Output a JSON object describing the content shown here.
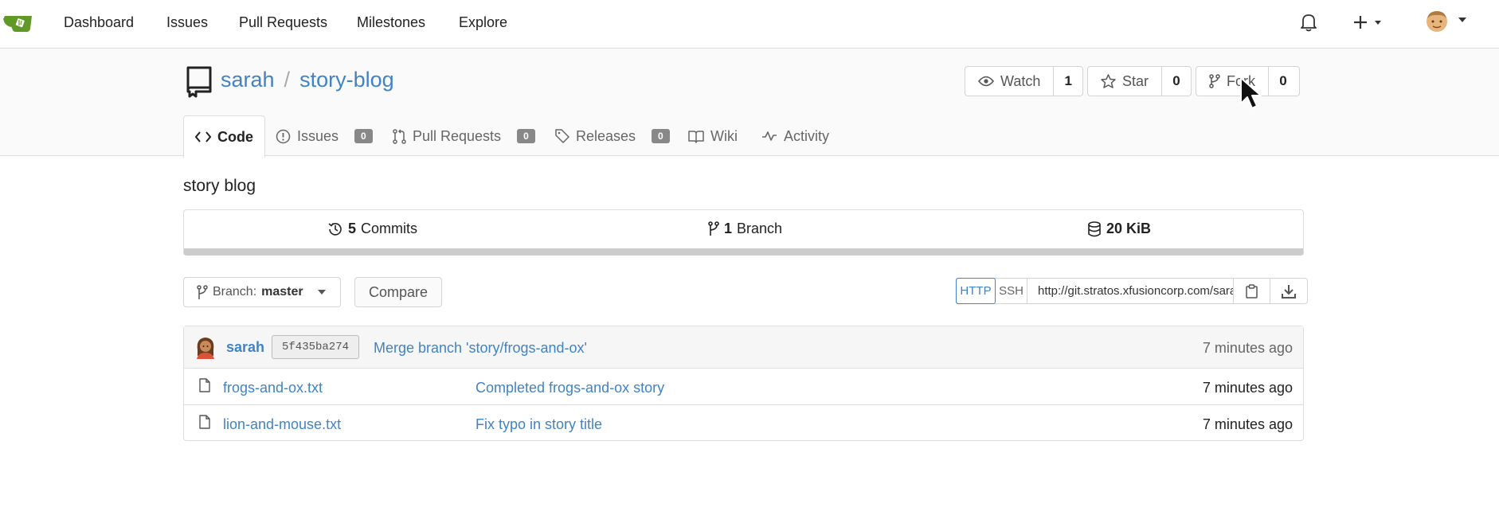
{
  "nav": {
    "items": [
      "Dashboard",
      "Issues",
      "Pull Requests",
      "Milestones",
      "Explore"
    ]
  },
  "repo": {
    "owner": "sarah",
    "name": "story-blog",
    "description": "story blog"
  },
  "actions": {
    "watch_label": "Watch",
    "watch_count": "1",
    "star_label": "Star",
    "star_count": "0",
    "fork_label": "Fork",
    "fork_count": "0"
  },
  "tabs": {
    "code": "Code",
    "issues": "Issues",
    "issues_count": "0",
    "pulls": "Pull Requests",
    "pulls_count": "0",
    "releases": "Releases",
    "releases_count": "0",
    "wiki": "Wiki",
    "activity": "Activity"
  },
  "stats": {
    "commits_count": "5",
    "commits_label": "Commits",
    "branch_count": "1",
    "branch_label": "Branch",
    "size": "20 KiB"
  },
  "toolbar": {
    "branch_prefix": "Branch:",
    "branch_name": "master",
    "compare": "Compare",
    "http": "HTTP",
    "ssh": "SSH",
    "clone_url": "http://git.stratos.xfusioncorp.com/sarah/story-blog.git"
  },
  "latest_commit": {
    "author": "sarah",
    "sha": "5f435ba274",
    "message": "Merge branch 'story/frogs-and-ox'",
    "time": "7 minutes ago"
  },
  "files": [
    {
      "name": "frogs-and-ox.txt",
      "message": "Completed frogs-and-ox story",
      "time": "7 minutes ago"
    },
    {
      "name": "lion-and-mouse.txt",
      "message": "Fix typo in story title",
      "time": "7 minutes ago"
    }
  ],
  "colors": {
    "link": "#4183c4",
    "logo": "#609926"
  }
}
